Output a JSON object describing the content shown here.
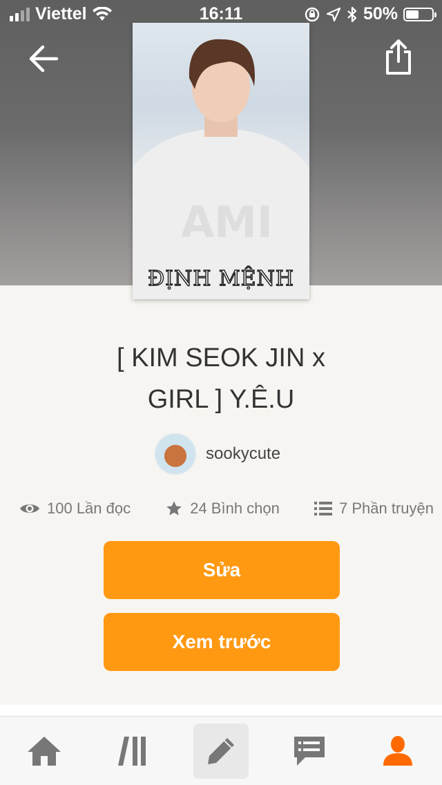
{
  "status_bar": {
    "carrier": "Viettel",
    "time": "16:11",
    "battery": "50%",
    "signal_bars": 4,
    "signal_bars_filled": 2
  },
  "header": {
    "back_icon": "arrow-left-icon",
    "share_icon": "share-icon"
  },
  "cover": {
    "title": "ĐỊNH MỆNH"
  },
  "story": {
    "title_line1": "[ KIM SEOK JIN x",
    "title_line2": "GIRL ] Y.Ê.U"
  },
  "author": {
    "name": "sookycute"
  },
  "stats": {
    "reads": "100 Lần đọc",
    "votes": "24 Bình chọn",
    "parts": "7 Phần truyện"
  },
  "actions": {
    "edit_label": "Sửa",
    "preview_label": "Xem trước"
  },
  "colors": {
    "accent": "#ff9912",
    "nav_active": "#ff6a00",
    "nav_inactive": "#777777"
  },
  "bottom_nav": {
    "items": [
      "home-icon",
      "library-icon",
      "write-icon",
      "messages-icon",
      "profile-icon"
    ],
    "active": "profile-icon"
  }
}
